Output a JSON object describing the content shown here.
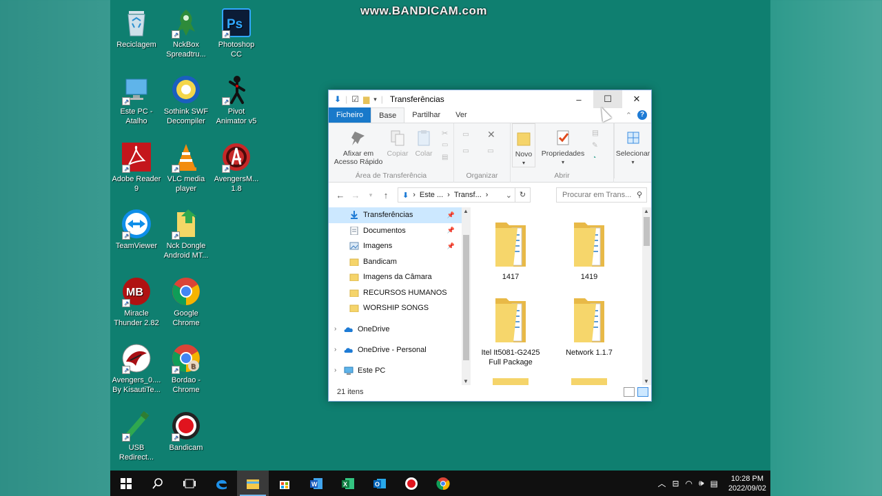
{
  "watermark": "www.BANDICAM.com",
  "desktop_icons": [
    {
      "label": "Reciclagem",
      "icon": "recycle-bin-icon"
    },
    {
      "label": "NckBox\nSpreadtru...",
      "icon": "nckbox-icon"
    },
    {
      "label": "Photoshop\nCC",
      "icon": "photoshop-icon"
    },
    {
      "label": "Este PC -\nAtalho",
      "icon": "this-pc-icon"
    },
    {
      "label": "Sothink SWF\nDecompiler",
      "icon": "sothink-icon"
    },
    {
      "label": "Pivot\nAnimator v5",
      "icon": "pivot-icon"
    },
    {
      "label": "Adobe Reader\n9",
      "icon": "adobe-reader-icon"
    },
    {
      "label": "VLC media\nplayer",
      "icon": "vlc-icon"
    },
    {
      "label": "AvengersM...\n1.8",
      "icon": "avengers-icon"
    },
    {
      "label": "TeamViewer",
      "icon": "teamviewer-icon"
    },
    {
      "label": "Nck Dongle\nAndroid MT...",
      "icon": "nck-dongle-icon"
    },
    {
      "label": "Miracle\nThunder 2.82",
      "icon": "miracle-icon"
    },
    {
      "label": "Google\nChrome",
      "icon": "chrome-icon"
    },
    {
      "label": "Avengers_0....\nBy KisautiTe...",
      "icon": "avengers-box-icon"
    },
    {
      "label": "Bordao -\nChrome",
      "icon": "chrome-profile-icon"
    },
    {
      "label": "USB\nRedirect...",
      "icon": "usb-redirector-icon"
    },
    {
      "label": "Bandicam",
      "icon": "bandicam-icon"
    }
  ],
  "explorer": {
    "title": "Transferências",
    "qat_icons": [
      "download-arrow-icon",
      "checkbox-icon",
      "folder-icon",
      "dropdown-icon"
    ],
    "tabs": [
      {
        "label": "Ficheiro",
        "active": false
      },
      {
        "label": "Base",
        "active": true
      },
      {
        "label": "Partilhar",
        "active": false
      },
      {
        "label": "Ver",
        "active": false
      }
    ],
    "ribbon": {
      "groups": [
        {
          "name": "Área de Transferência",
          "buttons": [
            "Afixar em\nAcesso Rápido",
            "Copiar",
            "Colar"
          ]
        },
        {
          "name": "Organizar",
          "buttons": []
        },
        {
          "name": "Abrir",
          "buttons": [
            "Novo",
            "Propriedades"
          ]
        },
        {
          "name": "",
          "buttons": [
            "Selecionar"
          ]
        }
      ]
    },
    "address": {
      "crumbs": [
        "Este ...",
        "Transf..."
      ],
      "search_placeholder": "Procurar em Trans..."
    },
    "nav": {
      "quick_access": [
        {
          "label": "Transferências",
          "icon": "download-icon",
          "pinned": true,
          "selected": true
        },
        {
          "label": "Documentos",
          "icon": "documents-icon",
          "pinned": true,
          "selected": false
        },
        {
          "label": "Imagens",
          "icon": "pictures-icon",
          "pinned": true,
          "selected": false
        },
        {
          "label": "Bandicam",
          "icon": "folder-icon",
          "pinned": false,
          "selected": false
        },
        {
          "label": "Imagens da Câmara",
          "icon": "folder-icon",
          "pinned": false,
          "selected": false
        },
        {
          "label": "RECURSOS HUMANOS",
          "icon": "folder-icon",
          "pinned": false,
          "selected": false
        },
        {
          "label": "WORSHIP SONGS",
          "icon": "folder-icon",
          "pinned": false,
          "selected": false
        }
      ],
      "roots": [
        {
          "label": "OneDrive",
          "icon": "onedrive-icon"
        },
        {
          "label": "OneDrive - Personal",
          "icon": "onedrive-icon"
        },
        {
          "label": "Este PC",
          "icon": "pc-icon"
        }
      ]
    },
    "files": [
      {
        "name": "1417"
      },
      {
        "name": "1419"
      },
      {
        "name": "Itel It5081-G2425\nFull Package"
      },
      {
        "name": "Network 1.1.7"
      }
    ],
    "status": "21 itens"
  },
  "taskbar": {
    "apps": [
      "start-icon",
      "search-icon",
      "task-view-icon",
      "edge-icon",
      "file-explorer-icon",
      "store-icon",
      "word-icon",
      "excel-icon",
      "outlook-icon",
      "bandicam-icon",
      "chrome-icon"
    ],
    "time": "10:28 PM",
    "date": "2022/09/02"
  }
}
